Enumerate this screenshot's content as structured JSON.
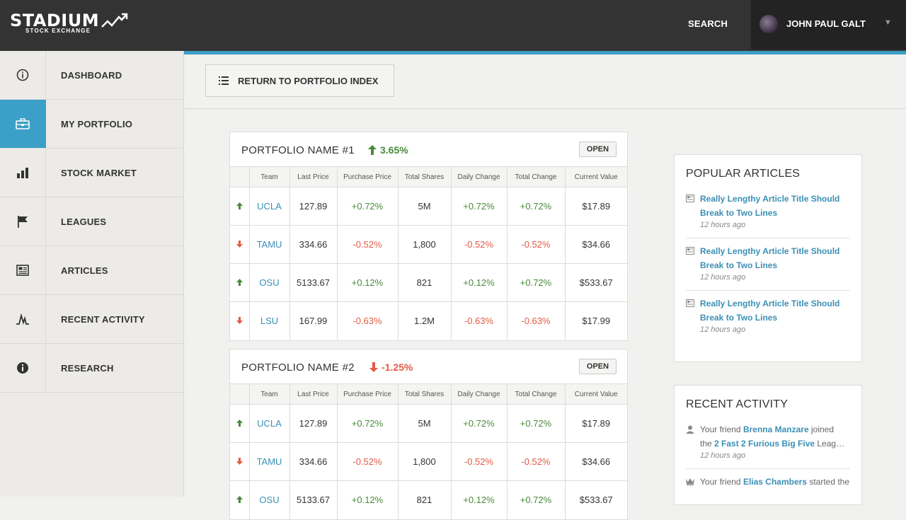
{
  "brand": {
    "name": "STADIUM",
    "tagline": "STOCK EXCHANGE"
  },
  "header": {
    "search_label": "SEARCH",
    "user_name": "JOHN PAUL GALT",
    "caret": "▼"
  },
  "sidebar": {
    "items": [
      {
        "label": "DASHBOARD",
        "icon": "info-circle-icon"
      },
      {
        "label": "MY PORTFOLIO",
        "icon": "briefcase-icon",
        "active": true
      },
      {
        "label": "STOCK MARKET",
        "icon": "bar-chart-icon"
      },
      {
        "label": "LEAGUES",
        "icon": "flag-icon"
      },
      {
        "label": "ARTICLES",
        "icon": "newspaper-icon"
      },
      {
        "label": "RECENT ACTIVITY",
        "icon": "activity-icon"
      },
      {
        "label": "RESEARCH",
        "icon": "info-icon"
      }
    ]
  },
  "toolbar": {
    "return_label": "RETURN TO PORTFOLIO INDEX"
  },
  "columns": [
    "Team",
    "Last Price",
    "Purchase Price",
    "Total Shares",
    "Daily Change",
    "Total Change",
    "Current Value"
  ],
  "portfolios": [
    {
      "name": "PORTFOLIO NAME #1",
      "change": "3.65%",
      "direction": "up",
      "open_label": "OPEN",
      "rows": [
        {
          "dir": "up",
          "team": "UCLA",
          "last": "127.89",
          "purchase": "+0.72%",
          "shares": "5M",
          "daily": "+0.72%",
          "total": "+0.72%",
          "value": "$17.89"
        },
        {
          "dir": "down",
          "team": "TAMU",
          "last": "334.66",
          "purchase": "-0.52%",
          "shares": "1,800",
          "daily": "-0.52%",
          "total": "-0.52%",
          "value": "$34.66"
        },
        {
          "dir": "up",
          "team": "OSU",
          "last": "5133.67",
          "purchase": "+0.12%",
          "shares": "821",
          "daily": "+0.12%",
          "total": "+0.72%",
          "value": "$533.67"
        },
        {
          "dir": "down",
          "team": "LSU",
          "last": "167.99",
          "purchase": "-0.63%",
          "shares": "1.2M",
          "daily": "-0.63%",
          "total": "-0.63%",
          "value": "$17.99"
        }
      ]
    },
    {
      "name": "PORTFOLIO NAME #2",
      "change": "-1.25%",
      "direction": "down",
      "open_label": "OPEN",
      "rows": [
        {
          "dir": "up",
          "team": "UCLA",
          "last": "127.89",
          "purchase": "+0.72%",
          "shares": "5M",
          "daily": "+0.72%",
          "total": "+0.72%",
          "value": "$17.89"
        },
        {
          "dir": "down",
          "team": "TAMU",
          "last": "334.66",
          "purchase": "-0.52%",
          "shares": "1,800",
          "daily": "-0.52%",
          "total": "-0.52%",
          "value": "$34.66"
        },
        {
          "dir": "up",
          "team": "OSU",
          "last": "5133.67",
          "purchase": "+0.12%",
          "shares": "821",
          "daily": "+0.12%",
          "total": "+0.72%",
          "value": "$533.67"
        }
      ]
    }
  ],
  "popular": {
    "title": "POPULAR ARTICLES",
    "articles": [
      {
        "line1": "Really Lengthy Article Title Should",
        "line2": "Break to Two Lines",
        "time": "12 hours ago"
      },
      {
        "line1": "Really Lengthy Article Title Should",
        "line2": "Break to Two Lines",
        "time": "12 hours ago"
      },
      {
        "line1": "Really Lengthy Article Title Should",
        "line2": "Break to Two Lines",
        "time": "12 hours ago"
      }
    ]
  },
  "activity": {
    "title": "RECENT ACTIVITY",
    "items": [
      {
        "pre": "Your friend ",
        "friend": "Brenna Manzare",
        "mid": " joined",
        "pre2": "the ",
        "link": "2 Fast 2 Furious Big Five",
        "post": " Leag…",
        "time": "12 hours ago"
      },
      {
        "pre": "Your friend ",
        "friend": "Elias Chambers",
        "mid": " started the"
      }
    ]
  }
}
